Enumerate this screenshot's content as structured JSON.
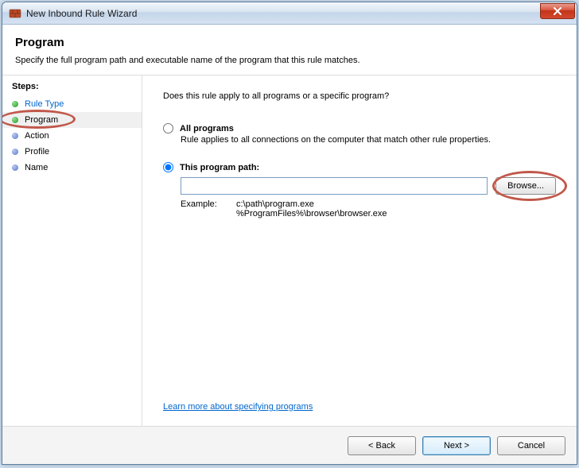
{
  "titlebar": {
    "title": "New Inbound Rule Wizard",
    "close": "X"
  },
  "header": {
    "title": "Program",
    "subtitle": "Specify the full program path and executable name of the program that this rule matches."
  },
  "sidebar": {
    "steps_label": "Steps:",
    "items": [
      {
        "label": "Rule Type"
      },
      {
        "label": "Program"
      },
      {
        "label": "Action"
      },
      {
        "label": "Profile"
      },
      {
        "label": "Name"
      }
    ]
  },
  "main": {
    "question": "Does this rule apply to all programs or a specific program?",
    "option_all": {
      "label": "All programs",
      "desc": "Rule applies to all connections on the computer that match other rule properties."
    },
    "option_path": {
      "label": "This program path:",
      "value": "",
      "browse": "Browse...",
      "example_label": "Example:",
      "example_text": "c:\\path\\program.exe\n%ProgramFiles%\\browser\\browser.exe"
    },
    "learn_more": "Learn more about specifying programs"
  },
  "footer": {
    "back": "< Back",
    "next": "Next >",
    "cancel": "Cancel"
  }
}
